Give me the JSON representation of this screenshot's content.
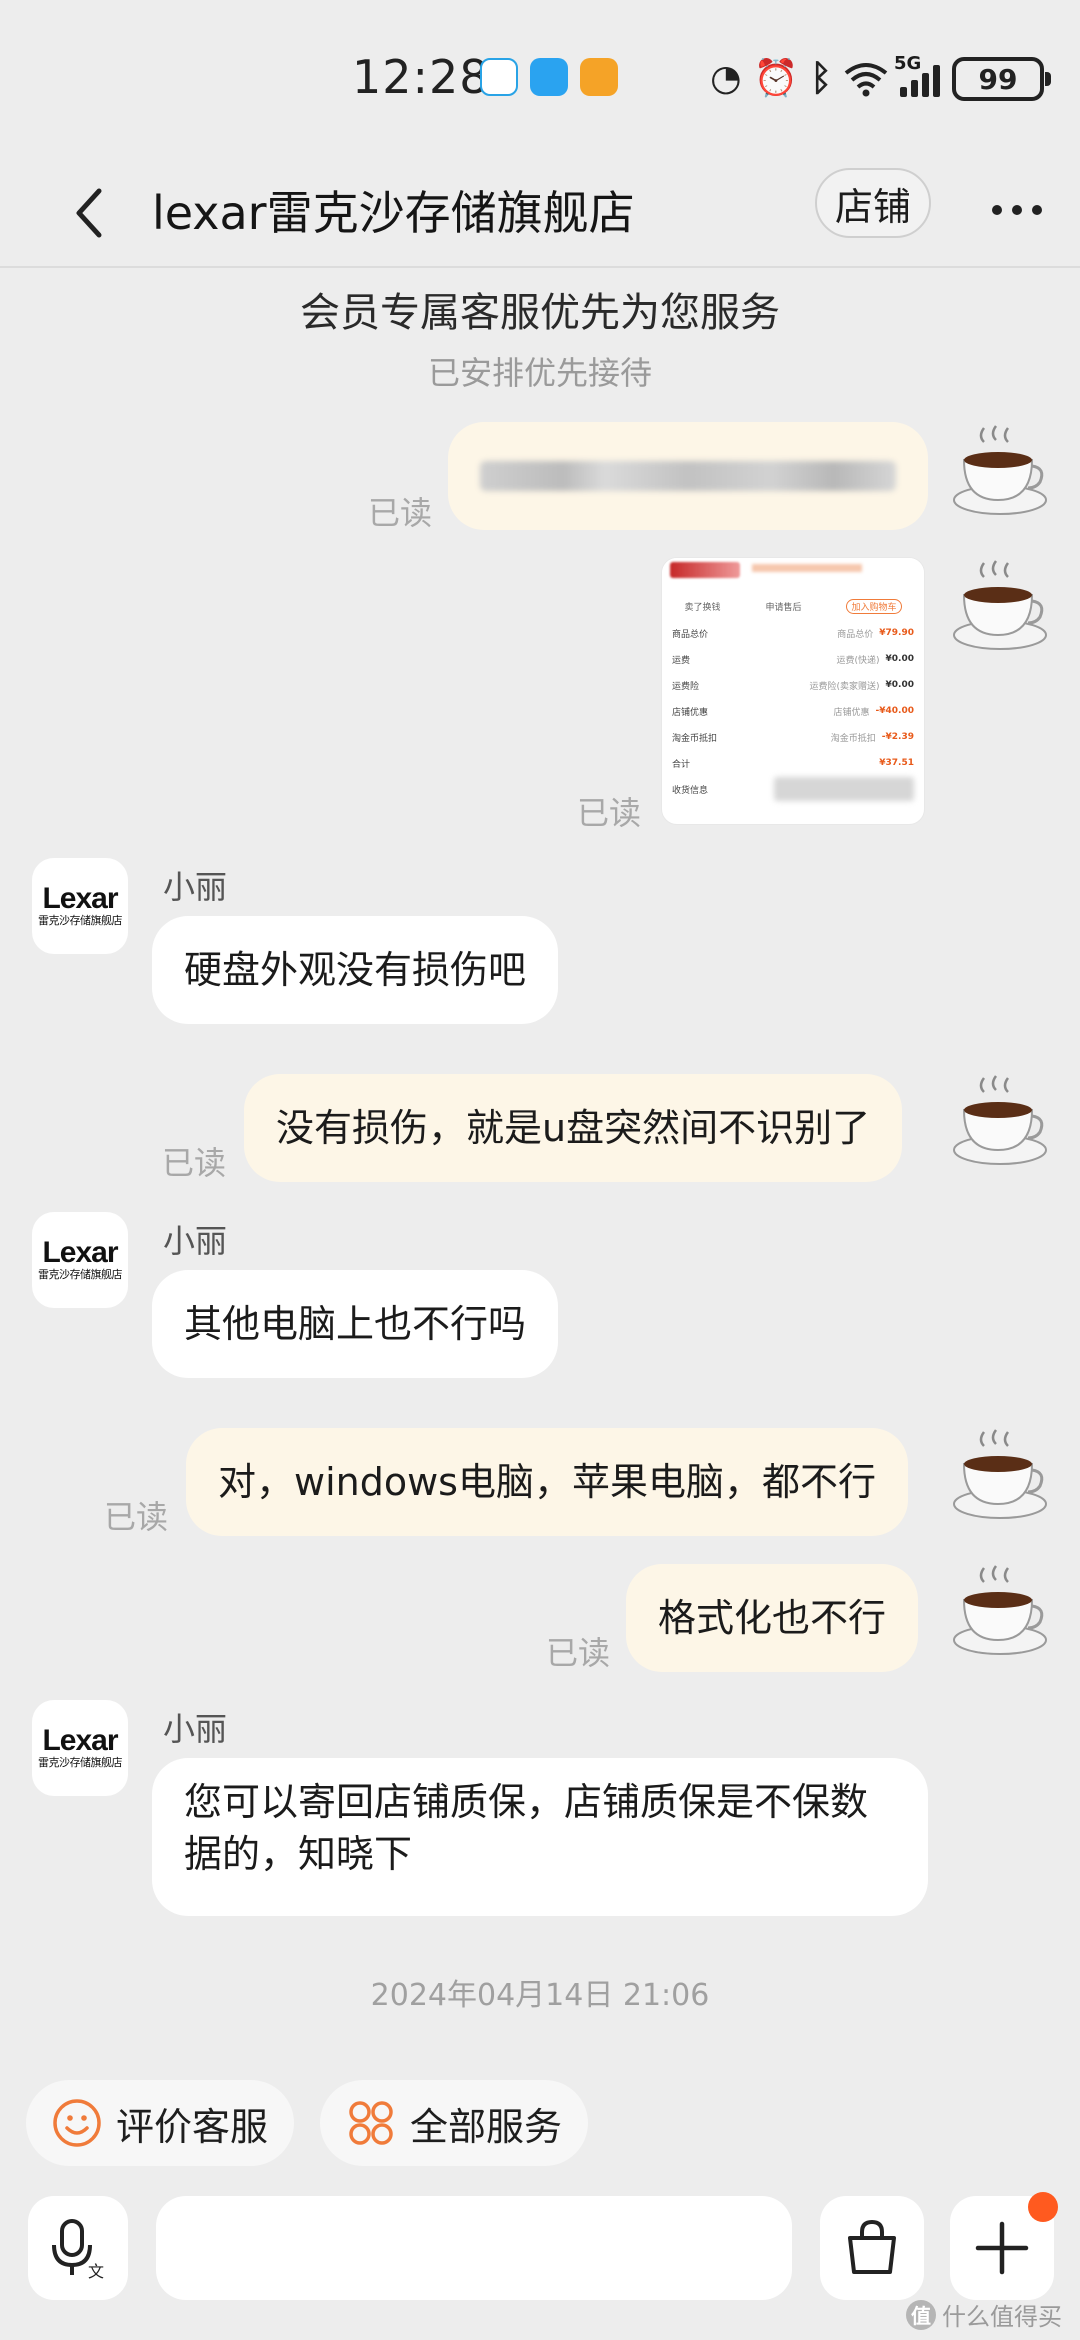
{
  "status_bar": {
    "time": "12:28",
    "battery": "99",
    "network": "5G"
  },
  "header": {
    "title": "lexar雷克沙存储旗舰店",
    "shop_button": "店铺"
  },
  "notices": {
    "main": "会员专属客服优先为您服务",
    "sub": "已安排优先接待",
    "timestamp": "2024年04月14日 21:06"
  },
  "agent": {
    "name": "小丽",
    "logo_text": "Lexar",
    "logo_sub": "雷克沙存储旗舰店"
  },
  "read_label": "已读",
  "messages": [
    {
      "from": "me",
      "text": ""
    },
    {
      "from": "me",
      "type": "image"
    },
    {
      "from": "agent",
      "text": "硬盘外观没有损伤吧"
    },
    {
      "from": "me",
      "text": "没有损伤，就是u盘突然间不识别了"
    },
    {
      "from": "agent",
      "text": "其他电脑上也不行吗"
    },
    {
      "from": "me",
      "text": "对，windows电脑，苹果电脑，都不行"
    },
    {
      "from": "me",
      "text": "格式化也不行"
    },
    {
      "from": "agent",
      "text": "您可以寄回店铺质保，店铺质保是不保数据的，知晓下"
    }
  ],
  "receipt": {
    "tabs": [
      "卖了换钱",
      "申请售后",
      "加入购物车"
    ],
    "rows": [
      {
        "label": "商品总价",
        "mid": "商品总价",
        "value": "¥79.90"
      },
      {
        "label": "运费",
        "mid": "运费(快递)",
        "value": "¥0.00"
      },
      {
        "label": "运费险",
        "mid": "运费险(卖家赠送)",
        "value": "¥0.00"
      },
      {
        "label": "店铺优惠",
        "mid": "店铺优惠",
        "value": "-¥40.00"
      },
      {
        "label": "淘金币抵扣",
        "mid": "淘金币抵扣",
        "value": "-¥2.39"
      },
      {
        "label": "合计",
        "mid": "",
        "value": "¥37.51"
      },
      {
        "label": "收货信息",
        "mid": "",
        "value": ""
      }
    ]
  },
  "quick_actions": [
    {
      "label": "评价客服",
      "icon": "smile-icon"
    },
    {
      "label": "全部服务",
      "icon": "grid-icon"
    }
  ],
  "colors": {
    "background": "#ededed",
    "my_bubble": "#fdf6e7",
    "agent_bubble": "#ffffff",
    "accent": "#f07b3a",
    "badge": "#ff5a1f"
  },
  "watermark": "什么值得买"
}
